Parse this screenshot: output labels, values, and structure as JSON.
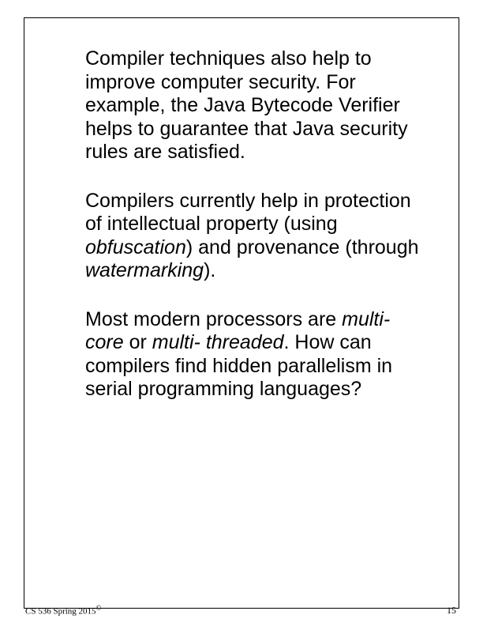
{
  "content": {
    "para1": "Compiler techniques also help to improve computer security. For example, the Java Bytecode Verifier helps to guarantee that Java security rules are satisfied.",
    "para2_a": "Compilers currently help in protection of intellectual property (using ",
    "para2_ob": "obfuscation",
    "para2_b": ") and provenance (through ",
    "para2_wm": "watermarking",
    "para2_c": ").",
    "para3_a": "Most modern processors are ",
    "para3_mc": "multi- core",
    "para3_b": " or ",
    "para3_mt": "multi- threaded",
    "para3_c": ". How can compilers find hidden parallelism in serial programming languages?"
  },
  "footer": {
    "course": "CS 536  Spring 2015",
    "copyright": "©",
    "page_number": "15"
  }
}
